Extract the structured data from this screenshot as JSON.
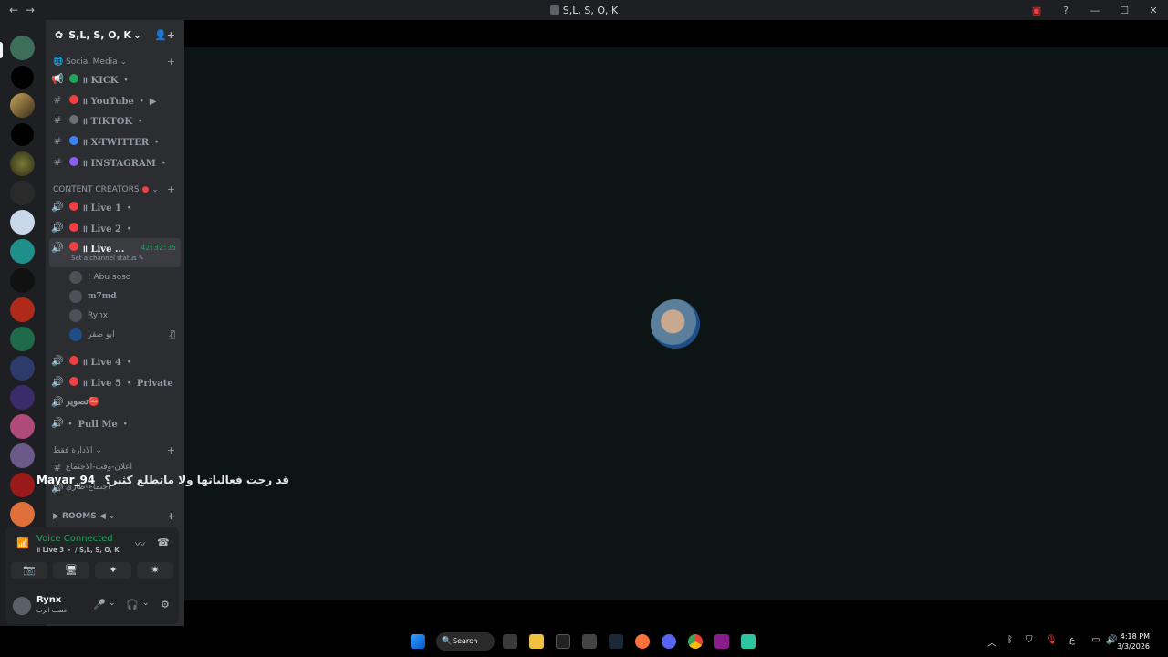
{
  "window": {
    "title": "S,L, S, O, K",
    "back": "←",
    "forward": "→",
    "icons": {
      "inbox": "▣",
      "help": "?",
      "min": "—",
      "max": "☐",
      "close": "✕"
    }
  },
  "server": {
    "name": "S,L, S, O, K",
    "gear": "✿",
    "chevron": "⌄",
    "invite": "👤+"
  },
  "categories": {
    "social": "Social Media ⌄",
    "creators": "CONTENT CREATORS",
    "admin": "الادارة فقط ⌄",
    "rooms": "▶ ROOMS ◀ ⌄",
    "plus": "+"
  },
  "channels": {
    "kick": "॥ KICK ・",
    "youtube": "॥ YouTube ・ ▶",
    "tiktok": "॥ TIKTOK ・",
    "twitter": "॥ X-TWITTER ・",
    "instagram": "॥ INSTAGRAM ・",
    "live1": "॥ Live 1 ・",
    "live2": "॥ Live 2 ・",
    "live3": "॥ Live ...",
    "live3_timer": "42:32:35",
    "live3_status": "Set a channel status ✎",
    "live4": "॥ Live 4 ・",
    "live5": "॥ Live 5 ・ Private",
    "photo": "تصوير⛔",
    "pullme": "・ Pull Me ・",
    "admin1": "اعلان-وقت-الاجتماع",
    "admin2": "اجتماع-طاري"
  },
  "voice_users": [
    {
      "name": "! Abu soso"
    },
    {
      "name": "m7md"
    },
    {
      "name": "Rynx"
    },
    {
      "name": "ابو صقر",
      "muted": "🎙̸"
    }
  ],
  "overlay": {
    "user": "Mayar_94",
    "message": "قد رحت فعالياتها ولا ماتطلع كثير؟"
  },
  "voice_panel": {
    "title": "Voice Connected",
    "subtitle": "॥ Live 3 ・ / S,L, S, O, K",
    "icons": {
      "signal": "📶",
      "noise": "〰",
      "disconnect": "☎",
      "cam": "📷",
      "screen": "🖥",
      "activity": "✦",
      "soundboard": "✷"
    }
  },
  "user_panel": {
    "name": "Rynx",
    "status": "عصب الرب",
    "icons": {
      "mic": "🎤",
      "headset": "🎧",
      "settings": "⚙",
      "chev": "⌄"
    }
  },
  "taskbar": {
    "search": "Search",
    "search_icon": "🔍",
    "tray": {
      "chevron": "︿",
      "lang": "ع"
    },
    "time": "4:18 PM",
    "date": "3/3/2026"
  },
  "colors": {
    "red": "#f23f42",
    "green": "#23a55a",
    "blue": "#3b82f6",
    "purple": "#8b5cf6",
    "grey": "#6b6f76"
  }
}
